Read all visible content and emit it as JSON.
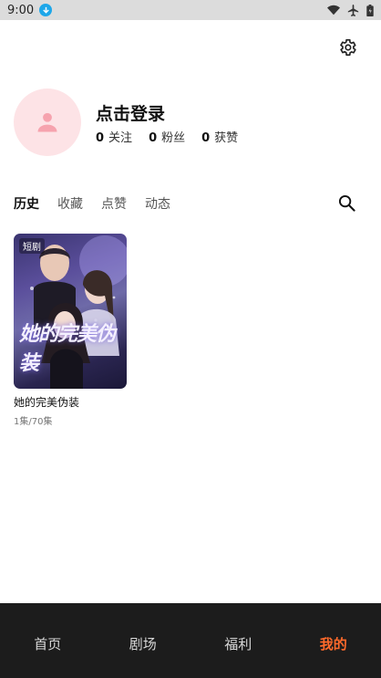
{
  "status_bar": {
    "time": "9:00",
    "icons": [
      "download-icon",
      "wifi-icon",
      "airplane-icon",
      "battery-icon"
    ]
  },
  "colors": {
    "accent": "#ff6a2b",
    "avatar_bg": "#fde3e6",
    "avatar_icon": "#f6a3ae",
    "nav_bg": "#1c1c1c",
    "status_download": "#1ea7e9"
  },
  "header": {
    "settings_icon": "gear-icon"
  },
  "profile": {
    "avatar_icon": "person-icon",
    "login_label": "点击登录",
    "stats": [
      {
        "value": "0",
        "label": "关注"
      },
      {
        "value": "0",
        "label": "粉丝"
      },
      {
        "value": "0",
        "label": "获赞"
      }
    ]
  },
  "tabs": {
    "items": [
      {
        "label": "历史",
        "active": true
      },
      {
        "label": "收藏",
        "active": false
      },
      {
        "label": "点赞",
        "active": false
      },
      {
        "label": "动态",
        "active": false
      }
    ],
    "search_icon": "search-icon"
  },
  "history": [
    {
      "badge": "短剧",
      "poster_title": "她的完美伪装",
      "title": "她的完美伪装",
      "episodes": "1集/70集"
    }
  ],
  "bottom_nav": {
    "items": [
      {
        "label": "首页",
        "active": false
      },
      {
        "label": "剧场",
        "active": false
      },
      {
        "label": "福利",
        "active": false
      },
      {
        "label": "我的",
        "active": true
      }
    ]
  }
}
